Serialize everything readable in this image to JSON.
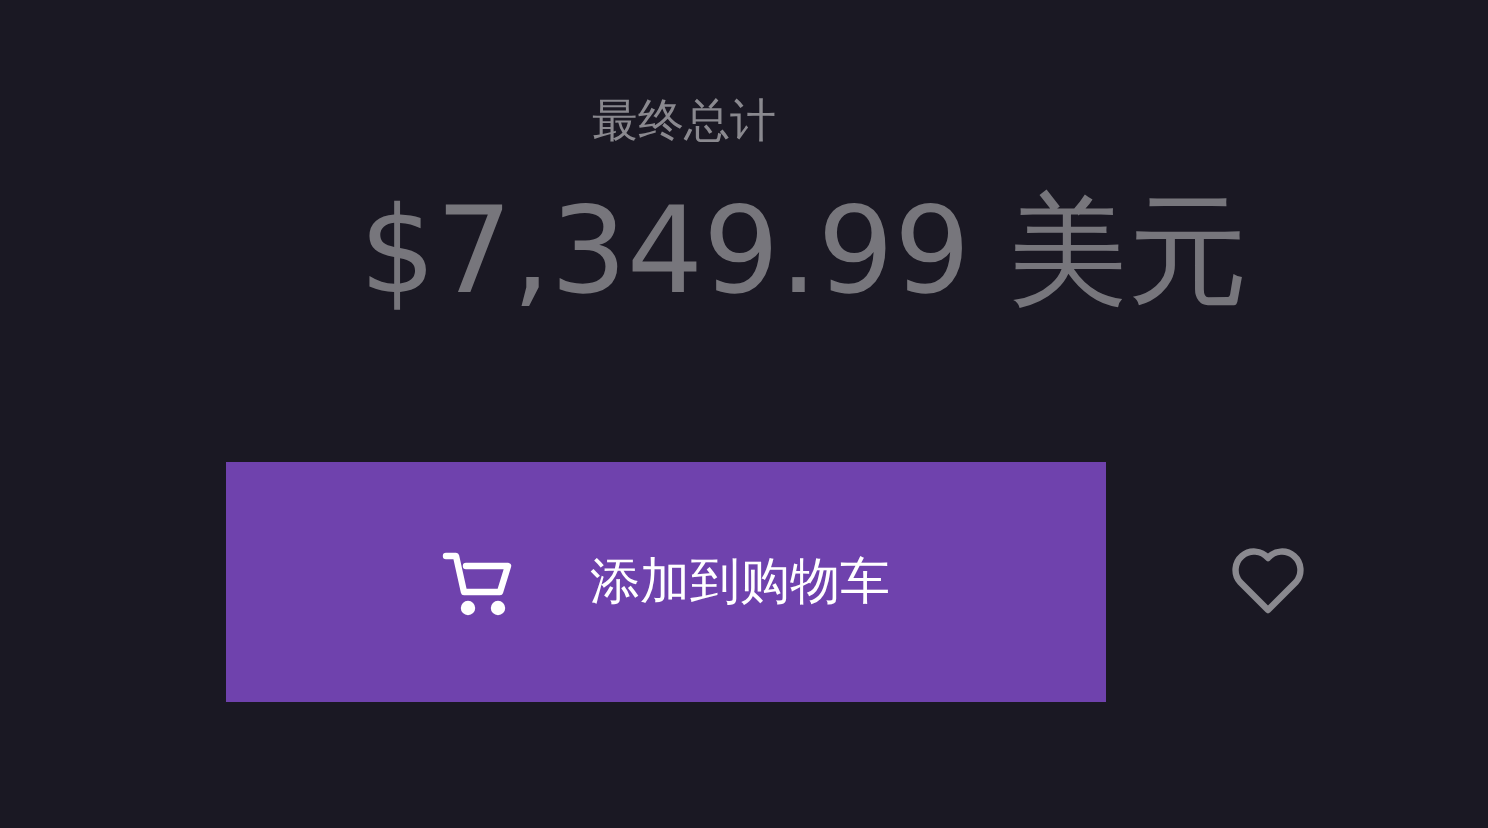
{
  "total_label": "最终总计",
  "total_price": "$7,349.99 美元",
  "add_to_cart_button": {
    "label": "添加到购物车"
  },
  "favorite": {
    "selected": false
  }
}
